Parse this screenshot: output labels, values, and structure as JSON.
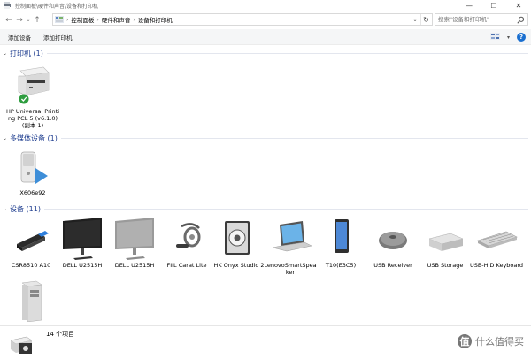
{
  "window": {
    "title": "控制面板\\硬件和声音\\设备和打印机",
    "caption_buttons": [
      "—",
      "☐",
      "✕"
    ]
  },
  "nav": {
    "back": "←",
    "forward": "→",
    "recent": "⌄",
    "up": "↑"
  },
  "address": {
    "crumbs": [
      "控制面板",
      "硬件和声音",
      "设备和打印机"
    ],
    "separator": "›",
    "dropdown": "⌄",
    "refresh": "↻"
  },
  "search": {
    "placeholder": "搜索\"设备和打印机\""
  },
  "commands": {
    "add_device": "添加设备",
    "add_printer": "添加打印机",
    "view_dropdown": "▾",
    "help": "?"
  },
  "groups": {
    "printers": {
      "title": "打印机 (1)",
      "chevron": "⌄"
    },
    "multimedia": {
      "title": "多媒体设备 (1)",
      "chevron": "⌄"
    },
    "devices": {
      "title": "设备 (11)",
      "chevron": "⌄"
    }
  },
  "printers": [
    {
      "label": "HP Universal Printing PCL 5 (v6.1.0) (副本 1)",
      "icon": "printer-icon",
      "status": "default-checkmark"
    }
  ],
  "multimedia": [
    {
      "label": "X606e92",
      "icon": "media-device-icon"
    }
  ],
  "devices": [
    {
      "label": "CSR8510 A10",
      "icon": "bluetooth-dongle-icon"
    },
    {
      "label": "DELL U2515H",
      "icon": "monitor-icon"
    },
    {
      "label": "DELL U2515H",
      "icon": "monitor-icon"
    },
    {
      "label": "FIIL Carat Lite",
      "icon": "headset-icon"
    },
    {
      "label": "HK Onyx Studio 2",
      "icon": "speaker-icon"
    },
    {
      "label": "LenovoSmartSpeaker",
      "icon": "laptop-icon"
    },
    {
      "label": "T10(E3C5)",
      "icon": "phone-icon"
    },
    {
      "label": "USB Receiver",
      "icon": "mouse-icon"
    },
    {
      "label": "USB Storage",
      "icon": "storage-icon"
    },
    {
      "label": "USB-HID Keyboard",
      "icon": "keyboard-icon"
    },
    {
      "label": "",
      "icon": "pc-tower-icon"
    }
  ],
  "status": {
    "count": "14 个项目",
    "watermark": "什么值得买",
    "watermark_logo": "值"
  },
  "colors": {
    "group_title": "#1e3d8f",
    "help": "#1a6fd0",
    "check": "#2e9d3f"
  }
}
